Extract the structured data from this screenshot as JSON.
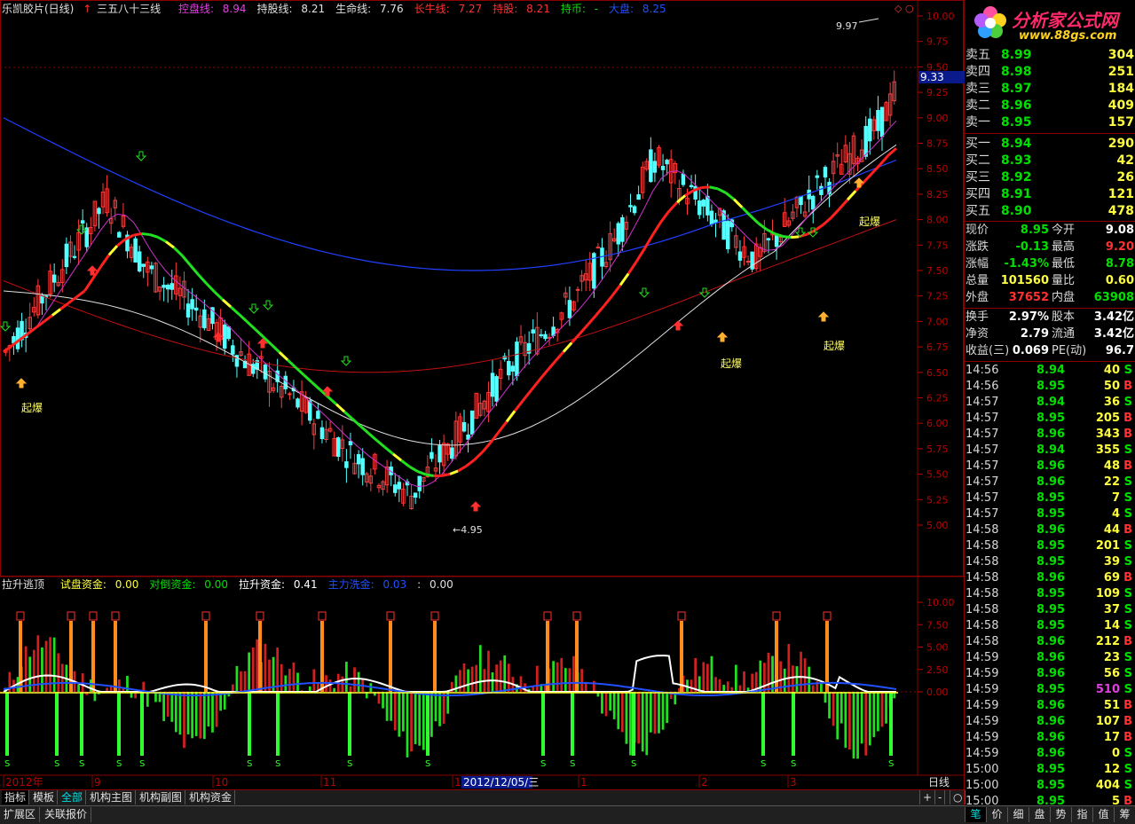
{
  "header": {
    "stock": "乐凯胶片(日线)",
    "indicator": "三五八十三线",
    "items": [
      {
        "label": "控盘线: ",
        "value": "8.94",
        "color": "#e040e0"
      },
      {
        "label": "持股线: ",
        "value": "8.21",
        "color": "#e0e0e0"
      },
      {
        "label": "生命线: ",
        "value": "7.76",
        "color": "#e0e0e0"
      },
      {
        "label": "长牛线: ",
        "value": "7.27",
        "color": "#ff3030"
      },
      {
        "label": "持股: ",
        "value": "8.21",
        "color": "#ff3030"
      },
      {
        "label": "持币: ",
        "value": "-",
        "color": "#00e000"
      },
      {
        "label": "大盘: ",
        "value": "8.25",
        "color": "#2050ff"
      }
    ]
  },
  "sub_header": {
    "title": "拉升逃顶",
    "items": [
      {
        "label": "试盘资金: ",
        "value": "0.00",
        "color": "#ffff40"
      },
      {
        "label": "对倒资金: ",
        "value": "0.00",
        "color": "#00e000"
      },
      {
        "label": "拉升资金: ",
        "value": "0.41",
        "color": "#ffffff"
      },
      {
        "label": "主力洗金: ",
        "value": "0.03",
        "color": "#2050ff"
      },
      {
        "label": ": ",
        "value": "0.00",
        "color": "#e0e0e0"
      }
    ]
  },
  "main_axis": {
    "ticks": [
      "10.00",
      "9.75",
      "9.50",
      "9.25",
      "9.00",
      "8.75",
      "8.50",
      "8.25",
      "8.00",
      "7.75",
      "7.50",
      "7.25",
      "7.00",
      "6.75",
      "6.50",
      "6.25",
      "6.00",
      "5.75",
      "5.50",
      "5.25",
      "5.00"
    ],
    "current_price": "9.33",
    "high_label": "9.97",
    "low_label": "4.95"
  },
  "sub_axis": {
    "ticks": [
      "10.00",
      "7.50",
      "5.00",
      "2.50",
      "0.00"
    ]
  },
  "annotations": {
    "qibao": "起爆"
  },
  "date_axis": {
    "labels": [
      "2012年",
      "9",
      "10",
      "11",
      "12",
      "1",
      "2",
      "3"
    ],
    "cursor_date": "2012/12/05/三",
    "period": "日线"
  },
  "logo": {
    "text": "分析家公式网",
    "url": "www.88gs.com"
  },
  "order_book": {
    "asks": [
      {
        "label": "卖五",
        "price": "8.99",
        "vol": "304"
      },
      {
        "label": "卖四",
        "price": "8.98",
        "vol": "251"
      },
      {
        "label": "卖三",
        "price": "8.97",
        "vol": "184"
      },
      {
        "label": "卖二",
        "price": "8.96",
        "vol": "409"
      },
      {
        "label": "卖一",
        "price": "8.95",
        "vol": "157"
      }
    ],
    "bids": [
      {
        "label": "买一",
        "price": "8.94",
        "vol": "290"
      },
      {
        "label": "买二",
        "price": "8.93",
        "vol": "42"
      },
      {
        "label": "买三",
        "price": "8.92",
        "vol": "26"
      },
      {
        "label": "买四",
        "price": "8.91",
        "vol": "121"
      },
      {
        "label": "买五",
        "price": "8.90",
        "vol": "478"
      }
    ]
  },
  "stats": [
    {
      "k1": "现价",
      "v1": "8.95",
      "c1": "#00e000",
      "k2": "今开",
      "v2": "9.08",
      "c2": "#ffffff"
    },
    {
      "k1": "涨跌",
      "v1": "-0.13",
      "c1": "#00e000",
      "k2": "最高",
      "v2": "9.20",
      "c2": "#ff3030"
    },
    {
      "k1": "涨幅",
      "v1": "-1.43%",
      "c1": "#00e000",
      "k2": "最低",
      "v2": "8.78",
      "c2": "#00e000"
    },
    {
      "k1": "总量",
      "v1": "101560",
      "c1": "#ffff40",
      "k2": "量比",
      "v2": "0.60",
      "c2": "#ffff40"
    },
    {
      "k1": "外盘",
      "v1": "37652",
      "c1": "#ff3030",
      "k2": "内盘",
      "v2": "63908",
      "c2": "#00e000"
    },
    {
      "k1": "换手",
      "v1": "2.97%",
      "c1": "#ffffff",
      "k2": "股本",
      "v2": "3.42亿",
      "c2": "#ffffff"
    },
    {
      "k1": "净资",
      "v1": "2.79",
      "c1": "#ffffff",
      "k2": "流通",
      "v2": "3.42亿",
      "c2": "#ffffff"
    },
    {
      "k1": "收益(三)",
      "v1": "0.069",
      "c1": "#ffffff",
      "k2": "PE(动)",
      "v2": "96.7",
      "c2": "#ffffff"
    }
  ],
  "ticks": [
    {
      "t": "14:56",
      "p": "8.94",
      "v": "40",
      "d": "S"
    },
    {
      "t": "14:56",
      "p": "8.95",
      "v": "50",
      "d": "B"
    },
    {
      "t": "14:57",
      "p": "8.94",
      "v": "36",
      "d": "S"
    },
    {
      "t": "14:57",
      "p": "8.95",
      "v": "205",
      "d": "B"
    },
    {
      "t": "14:57",
      "p": "8.96",
      "v": "343",
      "d": "B"
    },
    {
      "t": "14:57",
      "p": "8.94",
      "v": "355",
      "d": "S"
    },
    {
      "t": "14:57",
      "p": "8.96",
      "v": "48",
      "d": "B"
    },
    {
      "t": "14:57",
      "p": "8.96",
      "v": "22",
      "d": "S"
    },
    {
      "t": "14:57",
      "p": "8.95",
      "v": "7",
      "d": "S"
    },
    {
      "t": "14:57",
      "p": "8.95",
      "v": "4",
      "d": "S"
    },
    {
      "t": "14:58",
      "p": "8.96",
      "v": "44",
      "d": "B"
    },
    {
      "t": "14:58",
      "p": "8.95",
      "v": "201",
      "d": "S"
    },
    {
      "t": "14:58",
      "p": "8.95",
      "v": "39",
      "d": "S"
    },
    {
      "t": "14:58",
      "p": "8.96",
      "v": "69",
      "d": "B"
    },
    {
      "t": "14:58",
      "p": "8.95",
      "v": "109",
      "d": "S"
    },
    {
      "t": "14:58",
      "p": "8.95",
      "v": "37",
      "d": "S"
    },
    {
      "t": "14:58",
      "p": "8.95",
      "v": "14",
      "d": "S"
    },
    {
      "t": "14:58",
      "p": "8.96",
      "v": "212",
      "d": "B"
    },
    {
      "t": "14:59",
      "p": "8.96",
      "v": "23",
      "d": "S"
    },
    {
      "t": "14:59",
      "p": "8.96",
      "v": "56",
      "d": "S"
    },
    {
      "t": "14:59",
      "p": "8.95",
      "v": "510",
      "d": "S"
    },
    {
      "t": "14:59",
      "p": "8.96",
      "v": "51",
      "d": "B"
    },
    {
      "t": "14:59",
      "p": "8.96",
      "v": "107",
      "d": "B"
    },
    {
      "t": "14:59",
      "p": "8.96",
      "v": "17",
      "d": "B"
    },
    {
      "t": "14:59",
      "p": "8.96",
      "v": "0",
      "d": "S"
    },
    {
      "t": "15:00",
      "p": "8.95",
      "v": "12",
      "d": "S"
    },
    {
      "t": "15:00",
      "p": "8.95",
      "v": "404",
      "d": "S"
    },
    {
      "t": "15:00",
      "p": "8.95",
      "v": "5",
      "d": "B"
    }
  ],
  "tabs": [
    "指标",
    "模板",
    "全部",
    "机构主图",
    "机构副图",
    "机构资金"
  ],
  "tab_controls": [
    "+",
    "-",
    "○"
  ],
  "status_tabs": [
    "扩展区",
    "关联报价"
  ],
  "right_tabs": [
    "笔",
    "价",
    "细",
    "盘",
    "势",
    "指",
    "值",
    "筹"
  ],
  "chart_data": {
    "type": "candlestick",
    "ylim": [
      4.95,
      10.0
    ],
    "high": 9.97,
    "low": 4.95,
    "last": 8.95,
    "x_labels": [
      "2012年",
      "9",
      "10",
      "11",
      "12",
      "1",
      "2",
      "3"
    ]
  }
}
